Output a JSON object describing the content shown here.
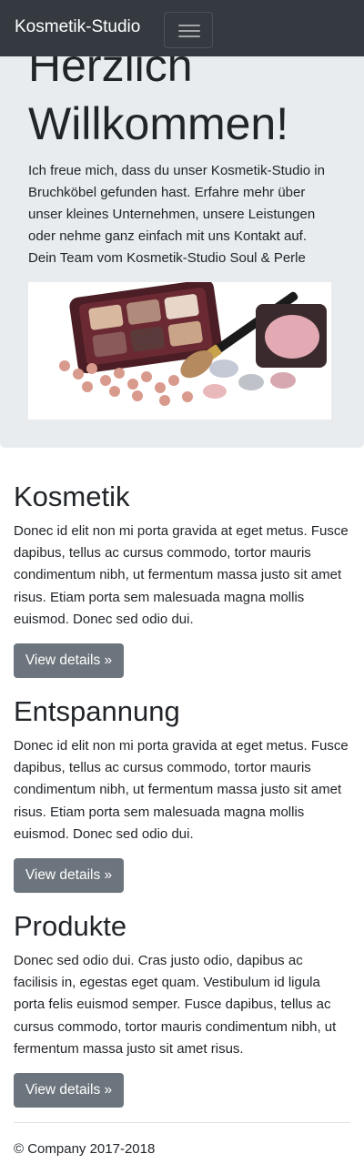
{
  "navbar": {
    "brand": "Kosmetik-Studio",
    "toggler_icon": "hamburger-menu-icon"
  },
  "jumbotron": {
    "title": "Herzlich Willkommen!",
    "text": "Ich freue mich, dass du unser Kosmetik-Studio in Bruchköbel gefunden hast. Erfahre mehr über unser kleines Unternehmen, unsere Leistungen oder nehme ganz einfach mit uns Kontakt auf. Dein Team vom Kosmetik-Studio Soul & Perle"
  },
  "sections": [
    {
      "heading": "Kosmetik",
      "text": "Donec id elit non mi porta gravida at eget metus. Fusce dapibus, tellus ac cursus commodo, tortor mauris condimentum nibh, ut fermentum massa justo sit amet risus. Etiam porta sem malesuada magna mollis euismod. Donec sed odio dui.",
      "button": "View details »"
    },
    {
      "heading": "Entspannung",
      "text": "Donec id elit non mi porta gravida at eget metus. Fusce dapibus, tellus ac cursus commodo, tortor mauris condimentum nibh, ut fermentum massa justo sit amet risus. Etiam porta sem malesuada magna mollis euismod. Donec sed odio dui.",
      "button": "View details »"
    },
    {
      "heading": "Produkte",
      "text": "Donec sed odio dui. Cras justo odio, dapibus ac facilisis in, egestas eget quam. Vestibulum id ligula porta felis euismod semper. Fusce dapibus, tellus ac cursus commodo, tortor mauris condimentum nibh, ut fermentum massa justo sit amet risus.",
      "button": "View details »"
    }
  ],
  "footer": {
    "text": "© Company 2017-2018"
  },
  "colors": {
    "navbar_bg": "#343a40",
    "jumbotron_bg": "#e9ecef",
    "button_bg": "#6c757d"
  }
}
